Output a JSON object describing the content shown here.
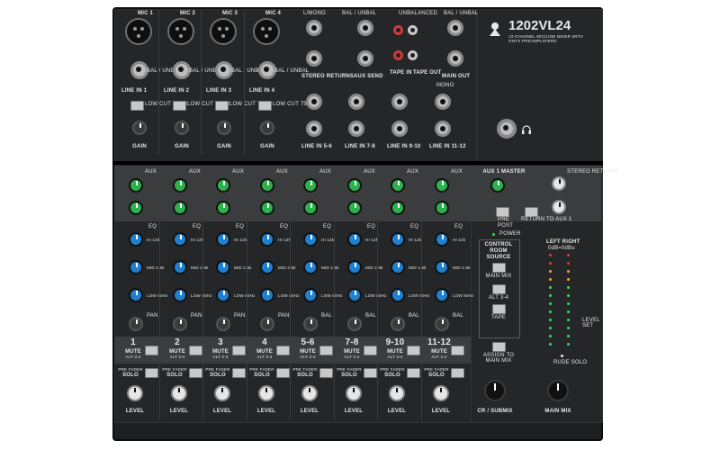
{
  "brand": {
    "model": "1202VL24",
    "tagline": "12-CHANNEL MIC/LINE MIXER WITH ONYX PREAMPLIFIERS"
  },
  "mic_channels": [
    {
      "mic_label": "MIC 1",
      "line_label": "LINE IN 1"
    },
    {
      "mic_label": "MIC 2",
      "line_label": "LINE IN 2"
    },
    {
      "mic_label": "MIC 3",
      "line_label": "LINE IN 3"
    },
    {
      "mic_label": "MIC 4",
      "line_label": "LINE IN 4"
    }
  ],
  "input_labels": {
    "bal_unbal": "BAL / UNBAL",
    "low_cut": "LOW CUT 75 Hz",
    "gain": "GAIN"
  },
  "rear_section": {
    "l_mono_top": "L/MONO",
    "bal_unbal": "BAL / UNBAL",
    "unbalanced": "UNBALANCED",
    "stereo_returns": "STEREO RETURNS",
    "aux_send": "AUX SEND",
    "tape_in": "TAPE IN",
    "tape_out": "TAPE OUT",
    "main_out": "MAIN OUT",
    "mono": "MONO",
    "line_5_6": "LINE IN 5-6",
    "line_7_8": "LINE IN 7-8",
    "line_9_10": "LINE IN 9-10",
    "line_11_12": "LINE IN 11-12",
    "l": "L",
    "r": "R"
  },
  "strips": [
    {
      "number": "1",
      "mute": "MUTE",
      "alt": "ALT 3-4",
      "pan": "PAN",
      "solo": "SOLO",
      "level": "LEVEL"
    },
    {
      "number": "2",
      "mute": "MUTE",
      "alt": "ALT 3-4",
      "pan": "PAN",
      "solo": "SOLO",
      "level": "LEVEL"
    },
    {
      "number": "3",
      "mute": "MUTE",
      "alt": "ALT 3-4",
      "pan": "PAN",
      "solo": "SOLO",
      "level": "LEVEL"
    },
    {
      "number": "4",
      "mute": "MUTE",
      "alt": "ALT 3-4",
      "pan": "PAN",
      "solo": "SOLO",
      "level": "LEVEL"
    },
    {
      "number": "5-6",
      "mute": "MUTE",
      "alt": "ALT 3-4",
      "pan": "BAL",
      "solo": "SOLO",
      "level": "LEVEL"
    },
    {
      "number": "7-8",
      "mute": "MUTE",
      "alt": "ALT 3-4",
      "pan": "BAL",
      "solo": "SOLO",
      "level": "LEVEL"
    },
    {
      "number": "9-10",
      "mute": "MUTE",
      "alt": "ALT 3-4",
      "pan": "BAL",
      "solo": "SOLO",
      "level": "LEVEL"
    },
    {
      "number": "11-12",
      "mute": "MUTE",
      "alt": "ALT 3-4",
      "pan": "BAL",
      "solo": "SOLO",
      "level": "LEVEL"
    }
  ],
  "strip_labels": {
    "aux": "AUX",
    "eq": "EQ",
    "hi": "HI 12k",
    "mid": "MID 2.5k",
    "low": "LOW 80Hz",
    "pre_fader": "PRE FADER"
  },
  "master": {
    "aux1_master": "AUX 1 MASTER",
    "stereo_returns": "STEREO RETURNS",
    "pre": "PRE",
    "post": "POST",
    "return_to_aux1": "RETURN TO AUX 1",
    "power": "POWER",
    "control_room_source": "CONTROL ROOM SOURCE",
    "main_mix_btn": "MAIN MIX",
    "alt_3_4": "ALT 3-4",
    "tape": "TAPE",
    "assign_to_main_mix": "ASSIGN TO MAIN MIX",
    "left_right": "LEFT  RIGHT",
    "odbu": "0dB=0dBu",
    "level_set": "LEVEL SET",
    "rude_solo": "RUDE SOLO",
    "cr_submix": "CR / SUBMIX",
    "main_mix": "MAIN MIX"
  },
  "colors": {
    "chassis": "#1e1f21",
    "aux_knob": "#2bb24c",
    "eq_knob": "#1f7fd1",
    "led_green": "#35e05a",
    "led_orange": "#f0a13a",
    "led_red": "#e23b3b"
  },
  "icons": [
    "headphones-icon",
    "mackie-logo-icon"
  ]
}
